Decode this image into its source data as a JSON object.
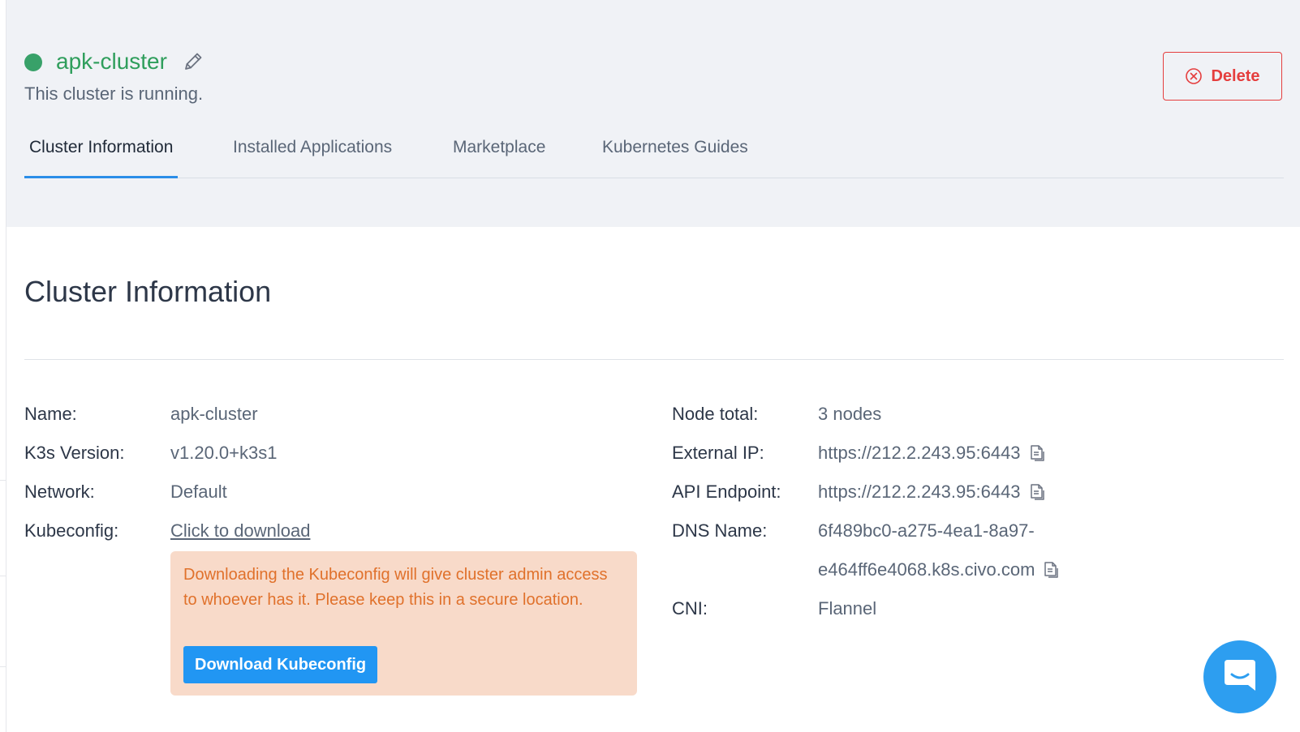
{
  "cluster": {
    "name": "apk-cluster",
    "status_text": "This cluster is running.",
    "status_color": "#38a169"
  },
  "header": {
    "delete_label": "Delete",
    "delete_color": "#e53e3e"
  },
  "tabs": [
    {
      "label": "Cluster Information",
      "active": true
    },
    {
      "label": "Installed Applications",
      "active": false
    },
    {
      "label": "Marketplace",
      "active": false
    },
    {
      "label": "Kubernetes Guides",
      "active": false
    }
  ],
  "section": {
    "title": "Cluster Information"
  },
  "info_left": [
    {
      "label": "Name:",
      "value": "apk-cluster"
    },
    {
      "label": "K3s Version:",
      "value": "v1.20.0+k3s1"
    },
    {
      "label": "Network:",
      "value": "Default"
    },
    {
      "label": "Kubeconfig:",
      "value": "Click to download"
    }
  ],
  "info_right": [
    {
      "label": "Node total:",
      "value": "3 nodes"
    },
    {
      "label": "External IP:",
      "value": "https://212.2.243.95:6443"
    },
    {
      "label": "API Endpoint:",
      "value": "https://212.2.243.95:6443"
    },
    {
      "label": "DNS Name:",
      "value": "6f489bc0-a275-4ea1-8a97-",
      "value_line2": "e464ff6e4068.k8s.civo.com"
    },
    {
      "label": "CNI:",
      "value": "Flannel"
    }
  ],
  "kubeconfig_warning": {
    "text": "Downloading the Kubeconfig will give cluster admin access to whoever has it. Please keep this in a secure location.",
    "button_label": "Download Kubeconfig"
  },
  "icons": {
    "edit": "pencil-icon",
    "delete": "close-circle-icon",
    "copy": "copy-icon",
    "chat": "chat-icon"
  },
  "colors": {
    "accent": "#2b8ee8",
    "brand_green": "#2f9e5c",
    "warning_bg": "#f8dac9",
    "warning_text": "#e0712b",
    "button_blue": "#2196f3"
  }
}
